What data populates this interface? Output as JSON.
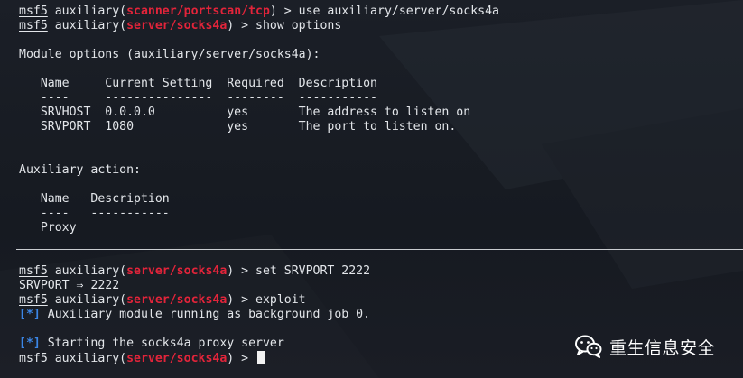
{
  "terminal": {
    "lines": [
      {
        "prompt": "msf5",
        "pre": " auxiliary(",
        "module": "scanner/portscan/tcp",
        "post": ") > use auxiliary/server/socks4a"
      },
      {
        "prompt": "msf5",
        "pre": " auxiliary(",
        "module": "server/socks4a",
        "post": ") > show options"
      },
      {
        "text": "Module options (auxiliary/server/socks4a):"
      },
      {
        "text": "   Name     Current Setting  Required  Description"
      },
      {
        "text": "   ----     ---------------  --------  -----------"
      },
      {
        "text": "   SRVHOST  0.0.0.0          yes       The address to listen on"
      },
      {
        "text": "   SRVPORT  1080             yes       The port to listen on."
      },
      {
        "text": "Auxiliary action:"
      },
      {
        "text": "   Name   Description"
      },
      {
        "text": "   ----   -----------"
      },
      {
        "text": "   Proxy"
      },
      {
        "prompt": "msf5",
        "pre": " auxiliary(",
        "module": "server/socks4a",
        "post": ") > set SRVPORT 2222"
      },
      {
        "text": "SRVPORT ⇒ 2222"
      },
      {
        "prompt": "msf5",
        "pre": " auxiliary(",
        "module": "server/socks4a",
        "post": ") > exploit"
      },
      {
        "tag": "[*]",
        "text": " Auxiliary module running as background job 0."
      },
      {
        "tag": "[*]",
        "text": " Starting the socks4a proxy server"
      },
      {
        "prompt": "msf5",
        "pre": " auxiliary(",
        "module": "server/socks4a",
        "post": ") > "
      }
    ]
  },
  "watermark": {
    "text": "重生信息安全",
    "icon": "wechat-icon"
  },
  "colors": {
    "module": "#e2243a",
    "info": "#3b86e6",
    "text": "#e3e6ea",
    "background": "#191d24"
  }
}
